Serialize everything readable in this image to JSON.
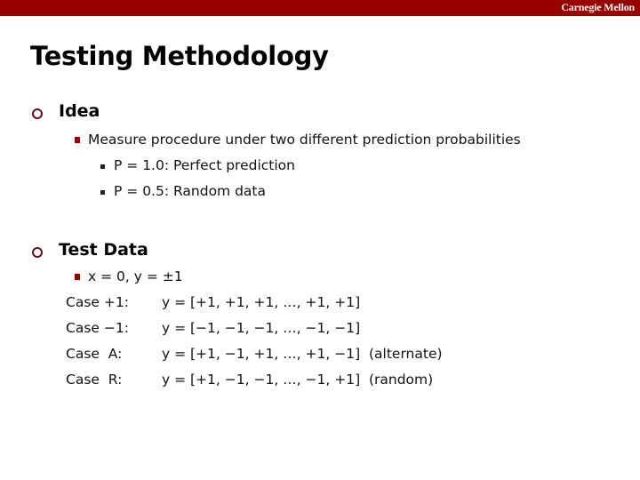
{
  "header": {
    "brand": "Carnegie Mellon",
    "bar_color": "#990000"
  },
  "slide": {
    "title": "Testing Methodology",
    "sections": [
      {
        "heading": "Idea",
        "bullet_icon": "hollow-circle",
        "items": [
          {
            "text": "Measure procedure under two different prediction probabilities",
            "subitems": [
              "P = 1.0: Perfect prediction",
              "P = 0.5: Random data"
            ]
          }
        ]
      },
      {
        "heading": "Test Data",
        "bullet_icon": "hollow-circle",
        "items": [
          {
            "text": "x = 0, y = ±1"
          }
        ],
        "cases": [
          {
            "label": "Case +1:",
            "value": "y = [+1, +1, +1, …, +1, +1]"
          },
          {
            "label": "Case −1:",
            "value": "y = [−1, −1, −1, …, −1, −1]"
          },
          {
            "label": "Case  A:",
            "value": "y = [+1, −1, +1, …, +1, −1]  (alternate)"
          },
          {
            "label": "Case  R:",
            "value": "y = [+1, −1, −1, …, −1, +1]  (random)"
          }
        ]
      }
    ]
  }
}
